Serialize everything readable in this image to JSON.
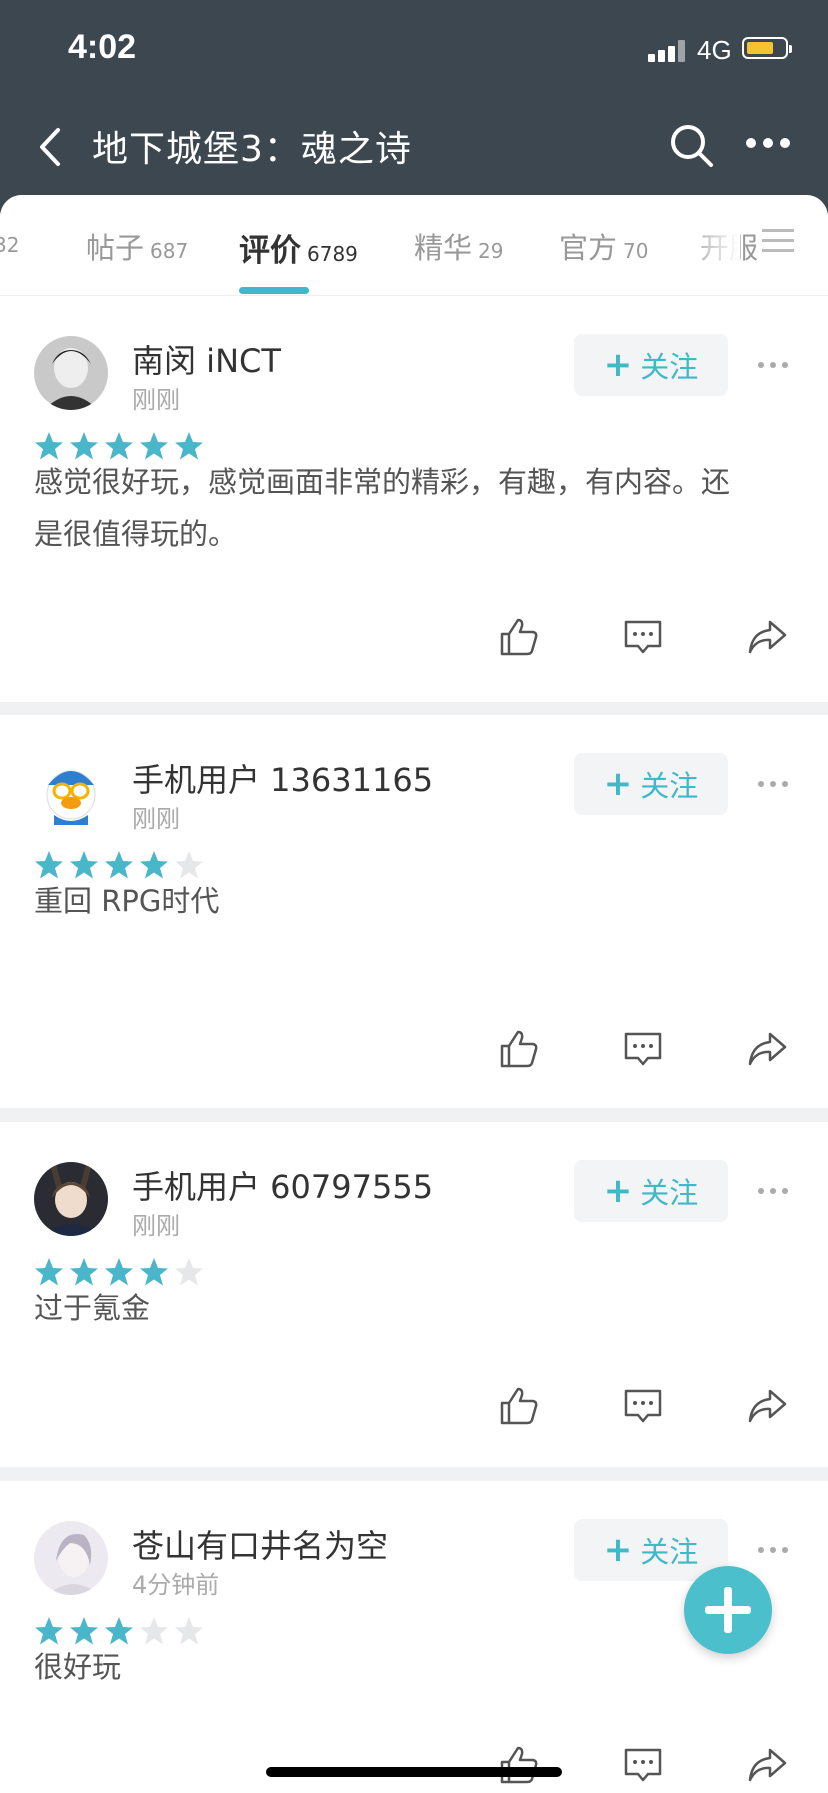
{
  "status_bar": {
    "time": "4:02",
    "network": "4G"
  },
  "nav": {
    "title": "地下城堡3：魂之诗"
  },
  "tabs": [
    {
      "label": "",
      "count": "32"
    },
    {
      "label": "帖子",
      "count": "687"
    },
    {
      "label": "评价",
      "count": "6789",
      "active": true
    },
    {
      "label": "精华",
      "count": "29"
    },
    {
      "label": "官方",
      "count": "70"
    },
    {
      "label": "开服",
      "count": ""
    }
  ],
  "follow_label": "关注",
  "colors": {
    "accent": "#3fb8c8",
    "header_bg": "#3d4750",
    "star_on": "#4ab6c9",
    "star_off": "#e6e7e8"
  },
  "reviews": [
    {
      "username": "南闵 iNCT",
      "time": "刚刚",
      "rating": 5,
      "content": "感觉很好玩，感觉画面非常的精彩，有趣，有内容。还是很值得玩的。"
    },
    {
      "username": "手机用户 13631165",
      "time": "刚刚",
      "rating": 4,
      "content": "重回 RPG时代"
    },
    {
      "username": "手机用户 60797555",
      "time": "刚刚",
      "rating": 4,
      "content": "过于氪金"
    },
    {
      "username": "苍山有口井名为空",
      "time": "4分钟前",
      "rating": 3,
      "content": "很好玩"
    }
  ]
}
